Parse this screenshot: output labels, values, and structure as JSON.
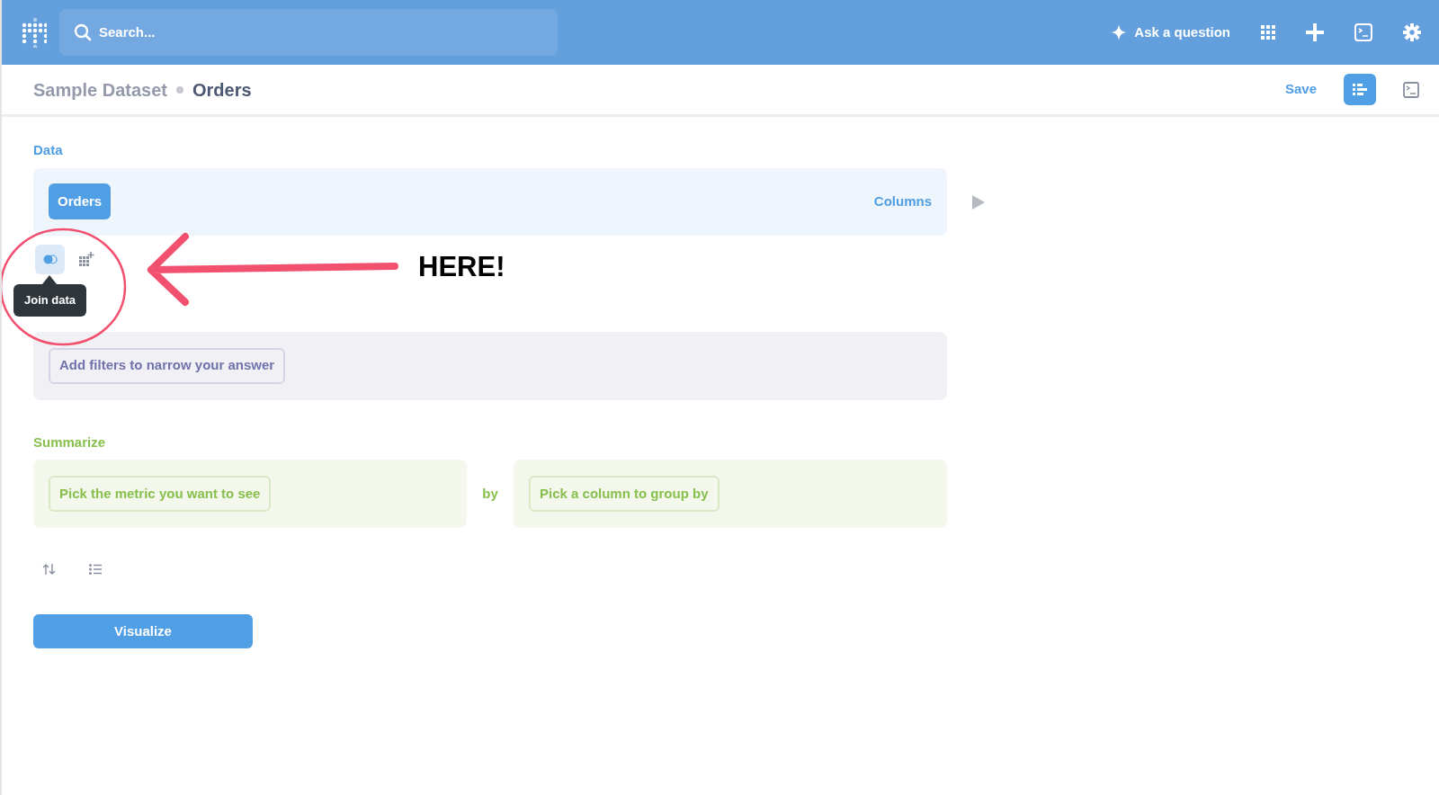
{
  "topbar": {
    "search": {
      "placeholder": "Search..."
    },
    "ask_button": "Ask a question"
  },
  "header": {
    "breadcrumb": {
      "parent": "Sample Dataset",
      "current": "Orders"
    },
    "save": "Save",
    "notebook_toggle": {
      "selected": true
    }
  },
  "data_section": {
    "heading": "Data",
    "table_button": "Orders",
    "columns_link": "Columns"
  },
  "step_actions": [
    {
      "kind": "join",
      "selected": true
    },
    {
      "kind": "custom-column",
      "selected": false
    }
  ],
  "tooltip": "Join data",
  "filter_section": {
    "placeholder_button": "Add filters to narrow your answer"
  },
  "summarize_section": {
    "heading": "Summarize",
    "metric_button": "Pick the metric you want to see",
    "by": "by",
    "group_button": "Pick a column to group by"
  },
  "extra_actions": [
    {
      "kind": "sort"
    },
    {
      "kind": "limit"
    }
  ],
  "visualize_button": "Visualize",
  "annotation": {
    "text": "HERE!"
  }
}
